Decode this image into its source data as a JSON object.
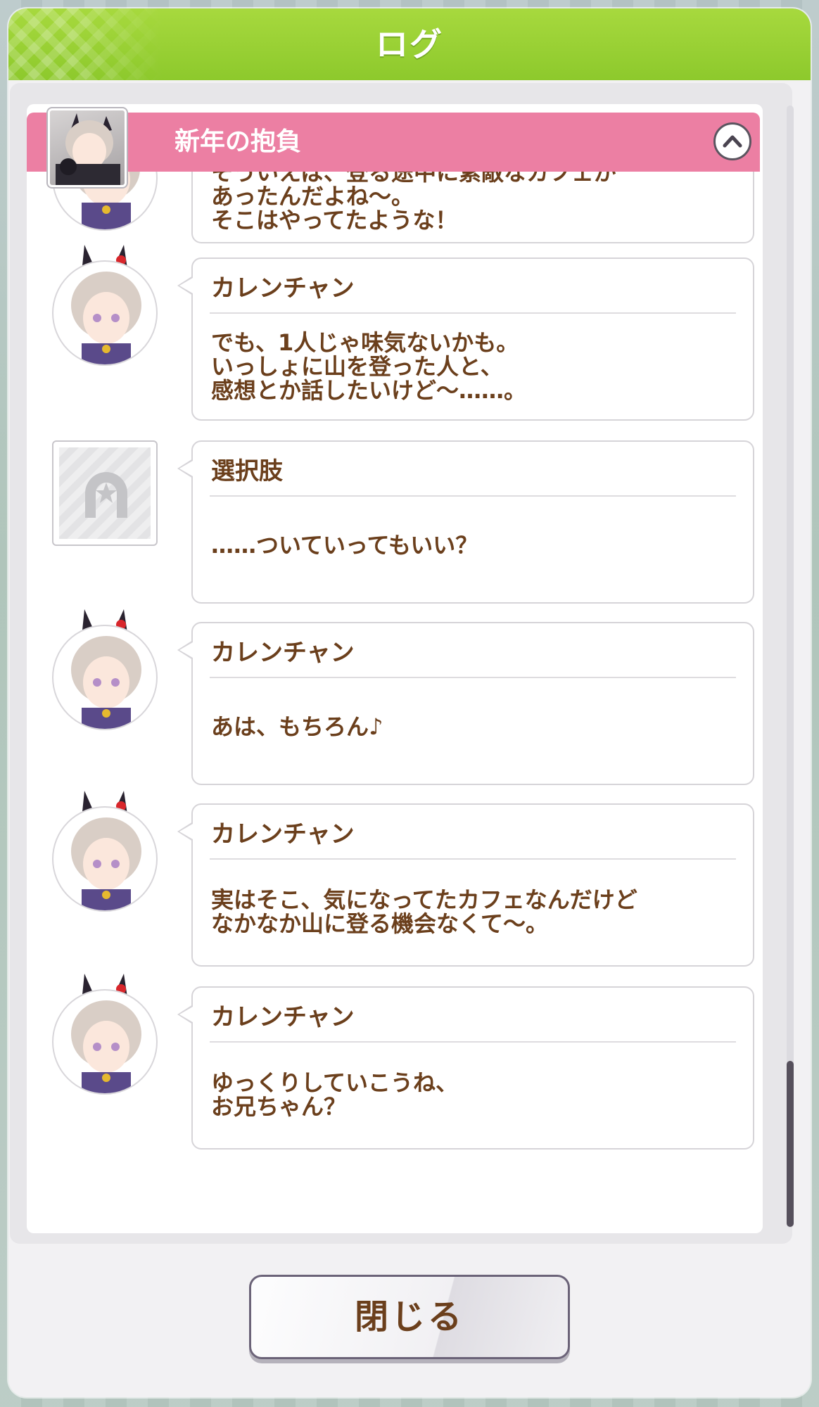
{
  "header": {
    "title": "ログ"
  },
  "section": {
    "title": "新年の抱負"
  },
  "entries": [
    {
      "type": "character",
      "speaker": "",
      "message": "そういえば、登る途中に素敵なカフェが\nあったんだよね〜。\nそこはやってたような！"
    },
    {
      "type": "character",
      "speaker": "カレンチャン",
      "message": "でも、1人じゃ味気ないかも。\nいっしょに山を登った人と、\n感想とか話したいけど〜……。"
    },
    {
      "type": "choice",
      "speaker": "選択肢",
      "message": "……ついていってもいい？"
    },
    {
      "type": "character",
      "speaker": "カレンチャン",
      "message": "あは、もちろん♪"
    },
    {
      "type": "character",
      "speaker": "カレンチャン",
      "message": "実はそこ、気になってたカフェなんだけど\nなかなか山に登る機会なくて〜。"
    },
    {
      "type": "character",
      "speaker": "カレンチャン",
      "message": "ゆっくりしていこうね、\nお兄ちゃん？"
    }
  ],
  "footer": {
    "close_label": "閉じる"
  },
  "colors": {
    "header": "#8dc92c",
    "section": "#ec7fa3",
    "text": "#6b3f1c"
  },
  "icons": {
    "collapse": "chevron-up-icon",
    "choice": "horseshoe-star-icon"
  }
}
